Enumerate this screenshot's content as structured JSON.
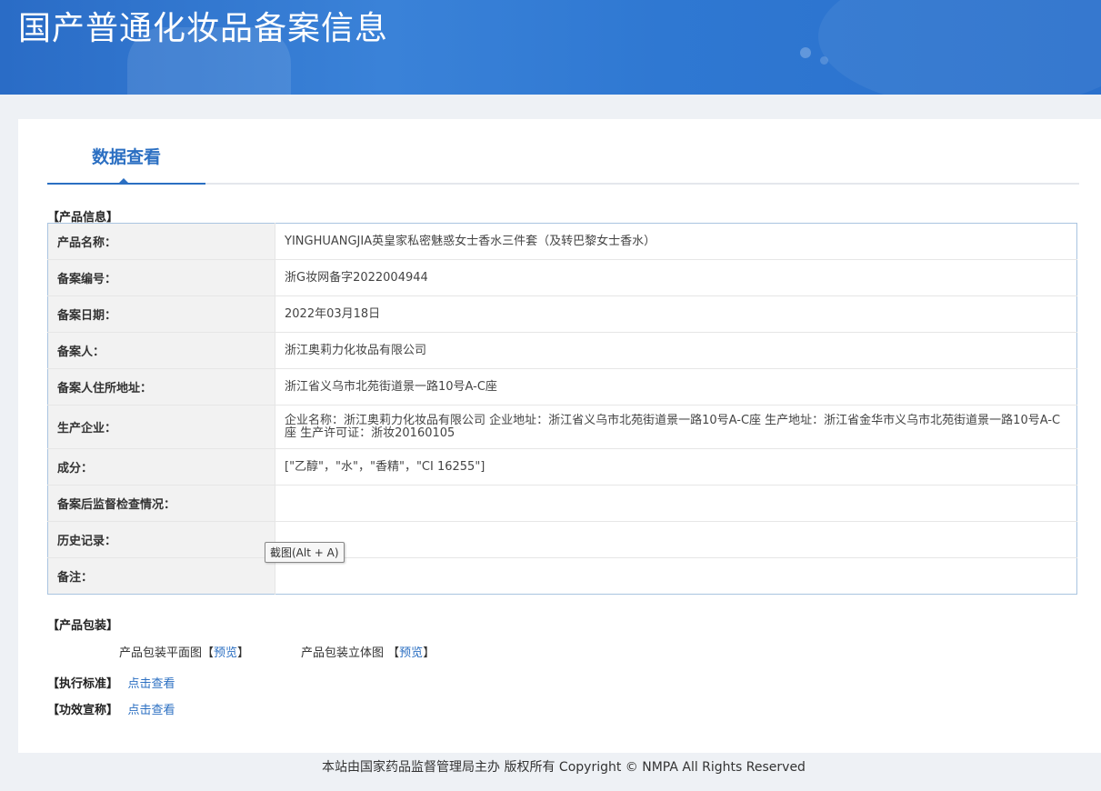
{
  "header": {
    "title": "国产普通化妆品备案信息"
  },
  "tabs": [
    {
      "label": "数据查看"
    }
  ],
  "product_info": {
    "section_label": "【产品信息】",
    "rows": [
      {
        "key": "产品名称：",
        "value": "YINGHUANGJIA英皇家私密魅惑女士香水三件套（及转巴黎女士香水）"
      },
      {
        "key": "备案编号：",
        "value": "浙G妆网备字2022004944"
      },
      {
        "key": "备案日期：",
        "value": "2022年03月18日"
      },
      {
        "key": "备案人：",
        "value": "浙江奥莉力化妆品有限公司"
      },
      {
        "key": "备案人住所地址：",
        "value": "浙江省义乌市北苑街道景一路10号A-C座"
      },
      {
        "key": "生产企业：",
        "value": "企业名称：浙江奥莉力化妆品有限公司 企业地址：浙江省义乌市北苑街道景一路10号A-C座 生产地址：浙江省金华市义乌市北苑街道景一路10号A-C座 生产许可证：浙妆20160105"
      },
      {
        "key": "成分：",
        "value": "[\"乙醇\"，\"水\"，\"香精\"，\"CI 16255\"]"
      },
      {
        "key": "备案后监督检查情况：",
        "value": ""
      },
      {
        "key": "历史记录：",
        "value": ""
      },
      {
        "key": "备注：",
        "value": ""
      }
    ]
  },
  "tooltip": {
    "text": "截图(Alt + A)"
  },
  "packaging": {
    "section_label": "【产品包装】",
    "flat": {
      "label": "产品包装平面图",
      "bracket_open": "【",
      "link": "预览",
      "bracket_close": "】"
    },
    "solid": {
      "label": "产品包装立体图",
      "bracket_open": "【",
      "link": "预览",
      "bracket_close": "】"
    }
  },
  "standard": {
    "label": "【执行标准】",
    "link": "点击查看"
  },
  "efficacy": {
    "label": "【功效宣称】",
    "link": "点击查看"
  },
  "footer": {
    "text": "本站由国家药品监督管理局主办 版权所有 Copyright © NMPA All Rights Reserved"
  }
}
